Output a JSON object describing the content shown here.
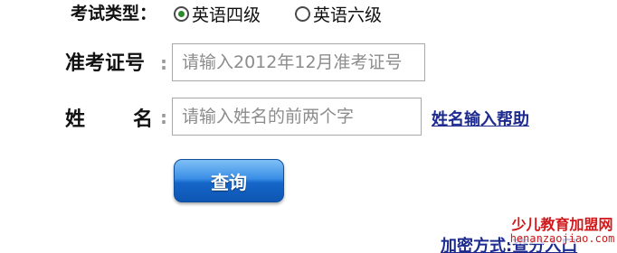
{
  "form": {
    "exam_type_label": "考试类型：",
    "exam_options": [
      {
        "label": "英语四级",
        "selected": true
      },
      {
        "label": "英语六级",
        "selected": false
      }
    ],
    "cert_label": "准考证号",
    "cert_colon": ":",
    "cert_placeholder": "请输入2012年12月准考证号",
    "name_label_first": "姓",
    "name_label_second": "名",
    "name_colon": ":",
    "name_placeholder": "请输入姓名的前两个字",
    "name_help_link": "姓名输入帮助",
    "query_button": "查询",
    "encrypt_link": "加密方式:查分入口"
  },
  "watermark": {
    "title": "少儿教育加盟网",
    "url": "henanzaojiao.com"
  },
  "colors": {
    "link": "#1d2b8f",
    "button_top": "#7fc0f6",
    "button_bottom": "#0e56b3",
    "radio_selected": "#2b8a2b",
    "watermark": "#d1171a"
  }
}
